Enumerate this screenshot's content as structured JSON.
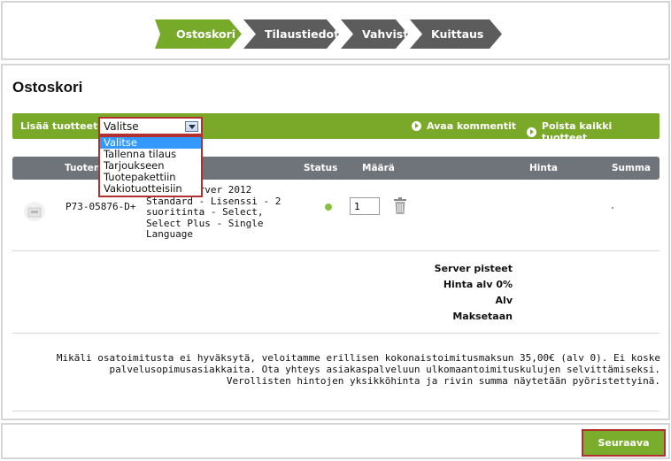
{
  "steps": [
    {
      "label": "Ostoskori",
      "active": true
    },
    {
      "label": "Tilaustiedot",
      "active": false
    },
    {
      "label": "Vahvista",
      "active": false
    },
    {
      "label": "Kuittaus",
      "active": false
    }
  ],
  "page_title": "Ostoskori",
  "toolbar": {
    "add_label": "Lisää tuotteet:",
    "select_value": "Valitse",
    "dropdown_options": [
      "Valitse",
      "Tallenna tilaus",
      "Tarjoukseen",
      "Tuotepakettiin",
      "Vakiotuotteisiin"
    ],
    "open_comments": "Avaa kommentit",
    "remove_all": "Poista kaikki tuotteet"
  },
  "table": {
    "headers": {
      "product": "Tuoten",
      "status": "Status",
      "qty": "Määrä",
      "price": "Hinta",
      "sum": "Summa"
    },
    "rows": [
      {
        "code": "P73-05876-D+",
        "description": "indows Server 2012 Standard - Lisenssi - 2 suoritinta - Select, Select Plus - Single Language",
        "status_color": "#88c040",
        "qty": "1"
      }
    ]
  },
  "totals": {
    "points": "Server pisteet",
    "vat0": "Hinta alv 0%",
    "vat": "Alv",
    "pay": "Maksetaan"
  },
  "note": "Mikäli osatoimitusta ei hyväksytä, veloitamme erillisen kokonaistoimitusmaksun 35,00€ (alv 0). Ei koske palvelusopimusasiakkaita. Ota yhteys asiakaspalveluun ulkomaantoimituskulujen selvittämiseksi. Verollisten hintojen yksikköhinta ja rivin summa näytetään pyöristettyinä.",
  "next_button": "Seuraava",
  "colors": {
    "accent": "#7aa92a",
    "step_inactive": "#5c5c5c",
    "table_header": "#6e747a",
    "highlight_border": "#b23030"
  }
}
